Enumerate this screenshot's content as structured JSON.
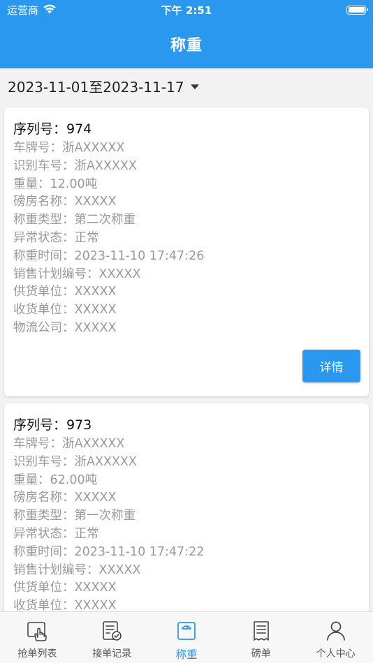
{
  "status_bar": {
    "carrier": "运营商",
    "time": "下午 2:51"
  },
  "nav": {
    "title": "称重"
  },
  "filter": {
    "date_range": "2023-11-01至2023-11-17"
  },
  "colors": {
    "primary": "#2b98f0",
    "muted_text": "#999999"
  },
  "records": [
    {
      "serial": "序列号：974",
      "plate": "车牌号：浙AXXXXX",
      "recognized_plate": "识别车号：浙AXXXXX",
      "weight": "重量：12.00吨",
      "scale_room": "磅房名称：XXXXX",
      "weigh_type": "称重类型：第二次称重",
      "abnormal_status": "异常状态：正常",
      "weigh_time": "称重时间：2023-11-10 17:47:26",
      "sales_plan": "销售计划编号：XXXXX",
      "supplier": "供货单位：XXXXX",
      "receiver": "收货单位：XXXXX",
      "logistics": "物流公司：XXXXX",
      "detail_label": "详情"
    },
    {
      "serial": "序列号：973",
      "plate": "车牌号：浙AXXXXX",
      "recognized_plate": "识别车号：浙AXXXXX",
      "weight": "重量：62.00吨",
      "scale_room": "磅房名称：XXXXX",
      "weigh_type": "称重类型：第一次称重",
      "abnormal_status": "异常状态：正常",
      "weigh_time": "称重时间：2023-11-10 17:47:22",
      "sales_plan": "销售计划编号：XXXXX",
      "supplier": "供货单位：XXXXX",
      "receiver": "收货单位：XXXXX"
    }
  ],
  "tabs": [
    {
      "label": "抢单列表",
      "icon": "grab-order-icon"
    },
    {
      "label": "接单记录",
      "icon": "order-record-icon"
    },
    {
      "label": "称重",
      "icon": "scale-icon",
      "active": true
    },
    {
      "label": "磅单",
      "icon": "receipt-icon"
    },
    {
      "label": "个人中心",
      "icon": "person-icon"
    }
  ]
}
